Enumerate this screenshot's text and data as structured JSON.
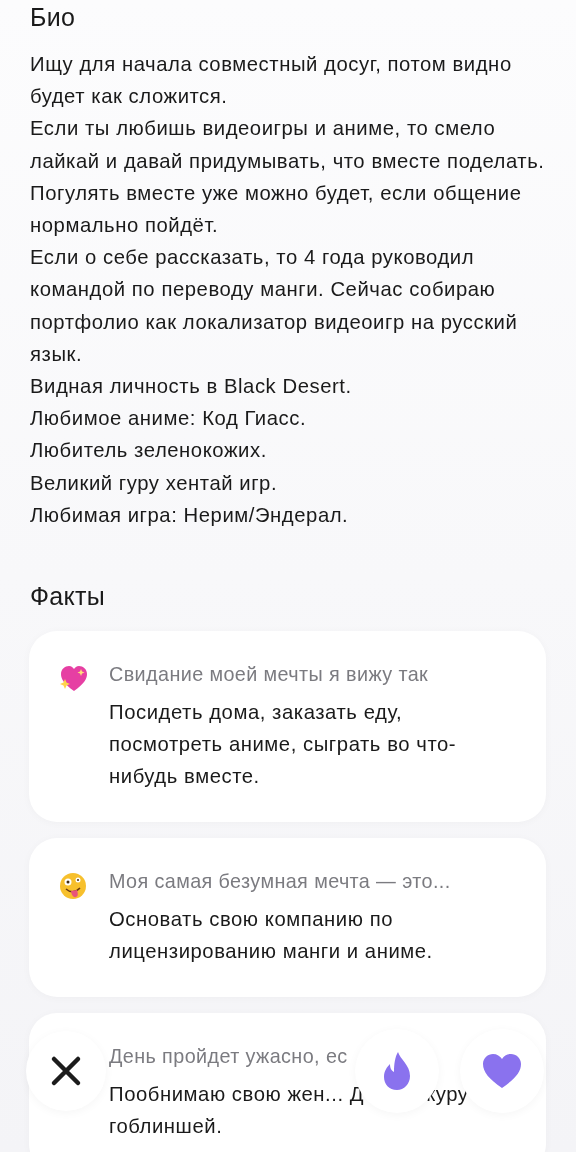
{
  "bio": {
    "title": "Био",
    "paragraphs": [
      "Ищу для начала совместный досуг, потом видно будет как сложится.",
      "Если ты любишь видеоигры и аниме, то смело лайкай и давай придумывать, что вместе поделать.",
      "Погулять вместе уже можно будет, если общение нормально пойдёт.",
      "Если о себе рассказать, то 4 года руководил командой по переводу манги. Сейчас собираю портфолио как локализатор видеоигр на русский язык.",
      "Видная личность в Black Desert.",
      "Любимое аниме: Код Гиасс.",
      "Любитель зеленокожих.",
      "Великий гуру хентай игр.",
      "Любимая игра: Нерим/Эндерал."
    ]
  },
  "facts": {
    "title": "Факты",
    "items": [
      {
        "kind": "heart",
        "title": "Свидание моей мечты я вижу так",
        "body": [
          [
            "Посидеть дома, заказать еду, посмотреть аниме, сыграть во что-нибудь вместе."
          ]
        ]
      },
      {
        "kind": "face",
        "title": "Моя самая безумная мечта — это...",
        "body": [
          [
            "Основать свою компанию по лицензированию манги и аниме."
          ]
        ]
      },
      {
        "kind": "plain",
        "title": "День пройдет ужасно, ес",
        "body": [
          [
            "Пообнимаю свою жен... Д",
            "куру"
          ],
          [
            "гоблиншей."
          ]
        ]
      }
    ]
  },
  "actions": [
    {
      "kind": "dislike"
    },
    {
      "kind": "superlike"
    },
    {
      "kind": "like"
    }
  ]
}
